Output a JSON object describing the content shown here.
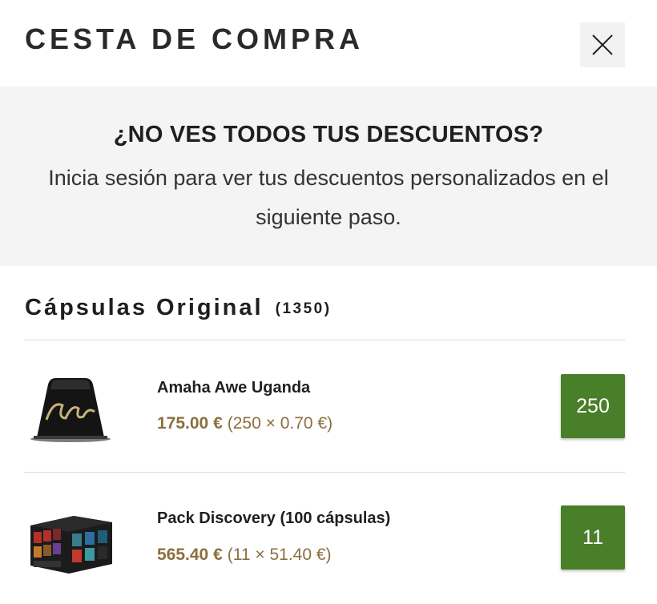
{
  "header": {
    "title": "CESTA DE COMPRA",
    "close_icon": "close-icon"
  },
  "banner": {
    "heading": "¿NO VES TODOS TUS DESCUENTOS?",
    "body": "Inicia sesión para ver tus descuentos personalizados en el siguiente paso."
  },
  "section": {
    "title": "Cápsulas Original",
    "count": "(1350)"
  },
  "items": [
    {
      "name": "Amaha Awe Uganda",
      "price": "175.00 €",
      "calc": "(250 × 0.70 €)",
      "quantity": "250",
      "image_icon": "capsule-image"
    },
    {
      "name": "Pack Discovery (100 cápsulas)",
      "price": "565.40 €",
      "calc": "(11 × 51.40 €)",
      "quantity": "11",
      "image_icon": "capsule-pack-image"
    }
  ],
  "colors": {
    "accent_green": "#4a7f2a",
    "price_brown": "#8c6f3f",
    "banner_bg": "#f4f4f4"
  }
}
